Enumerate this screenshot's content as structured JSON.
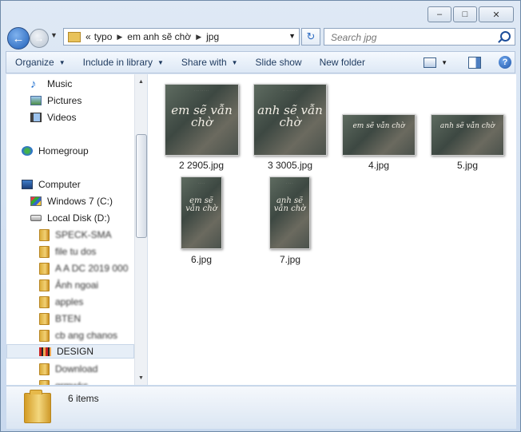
{
  "window": {
    "caption": {
      "minimize": "–",
      "maximize": "□",
      "close": "✕"
    }
  },
  "address": {
    "overflow": "«",
    "crumbs": [
      "typo",
      "em anh sẽ chờ",
      "jpg"
    ]
  },
  "search": {
    "placeholder": "Search jpg"
  },
  "toolbar": {
    "organize": "Organize",
    "include_in_library": "Include in library",
    "share_with": "Share with",
    "slide_show": "Slide show",
    "new_folder": "New folder"
  },
  "navpane": {
    "items": [
      {
        "label": "Music",
        "icon": "music-icon"
      },
      {
        "label": "Pictures",
        "icon": "pictures-icon"
      },
      {
        "label": "Videos",
        "icon": "videos-icon"
      },
      {
        "label": "Homegroup",
        "icon": "homegroup-icon"
      },
      {
        "label": "Computer",
        "icon": "computer-icon"
      },
      {
        "label": "Windows 7 (C:)",
        "icon": "windows-drive-icon"
      },
      {
        "label": "Local Disk (D:)",
        "icon": "drive-icon"
      },
      {
        "label": "SPECK-SMA",
        "icon": "folder-icon",
        "obscured": true
      },
      {
        "label": "file tu dos",
        "icon": "folder-icon",
        "obscured": true
      },
      {
        "label": "A A DC 2019 000",
        "icon": "folder-icon",
        "obscured": true
      },
      {
        "label": "Ảnh ngoai",
        "icon": "folder-icon",
        "obscured": true
      },
      {
        "label": "apples",
        "icon": "folder-icon",
        "obscured": true
      },
      {
        "label": "BTEN",
        "icon": "folder-icon",
        "obscured": true
      },
      {
        "label": "cb ang chanos",
        "icon": "folder-icon",
        "obscured": true
      },
      {
        "label": "DESIGN",
        "icon": "design-folder-icon",
        "selected": true
      },
      {
        "label": "Download",
        "icon": "folder-icon",
        "obscured": true
      },
      {
        "label": "grmwks",
        "icon": "folder-icon",
        "obscured": true
      }
    ]
  },
  "files": [
    {
      "name": "2 2905.jpg",
      "caption": "em sẽ vẫn chờ"
    },
    {
      "name": "3 3005.jpg",
      "caption": "anh sẽ vẫn chờ"
    },
    {
      "name": "4.jpg",
      "caption": "em sẽ vẫn chờ"
    },
    {
      "name": "5.jpg",
      "caption": "anh sẽ vẫn chờ"
    },
    {
      "name": "6.jpg",
      "caption": "em sẽ vẫn chờ"
    },
    {
      "name": "7.jpg",
      "caption": "anh sẽ vẫn chờ"
    }
  ],
  "details": {
    "count": "6 items"
  }
}
